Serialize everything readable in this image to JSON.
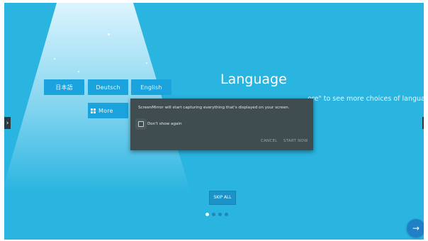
{
  "languages": {
    "japanese": "日本語",
    "german": "Deutsch",
    "english": "English",
    "more": "More"
  },
  "page": {
    "title": "Language",
    "hint": "ore\" to see more choices of language."
  },
  "dialog": {
    "message": "ScreenMirror will start capturing everything that's displayed on your screen.",
    "dont_show_again": "Don't show again",
    "cancel": "CANCEL",
    "start_now": "START NOW"
  },
  "skip_all": "SKIP ALL",
  "pagination": {
    "total": 4,
    "current": 1
  },
  "icons": {
    "left_arrow": "chevron-right-icon",
    "right_arrow": "chevron-left-icon",
    "next": "arrow-right-icon",
    "more": "grid-icon"
  },
  "colors": {
    "background": "#2ab4e0",
    "button": "#1aa3dc",
    "dialog": "#3f4d51",
    "next_button": "#1f7fc7"
  }
}
